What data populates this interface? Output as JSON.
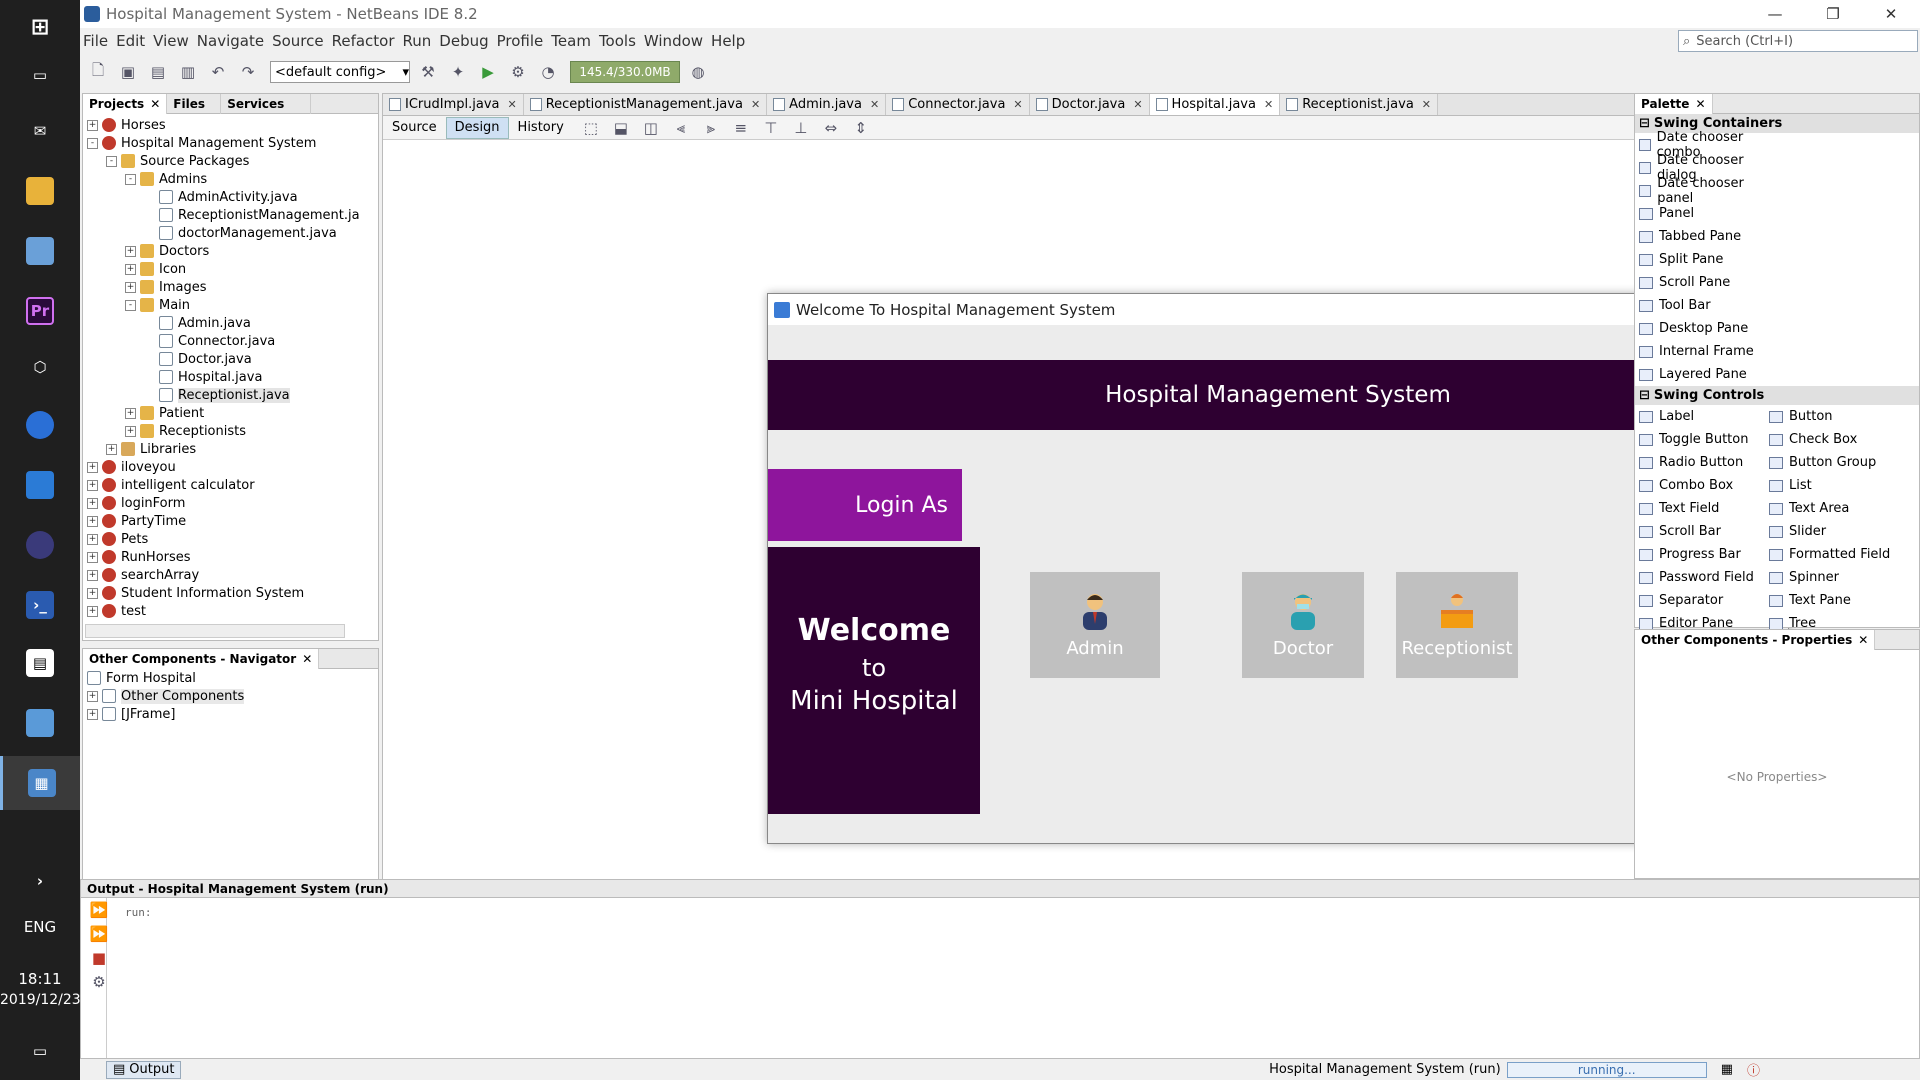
{
  "window": {
    "title": "Hospital Management System - NetBeans IDE 8.2"
  },
  "menu": [
    "File",
    "Edit",
    "View",
    "Navigate",
    "Source",
    "Refactor",
    "Run",
    "Debug",
    "Profile",
    "Team",
    "Tools",
    "Window",
    "Help"
  ],
  "search": {
    "placeholder": "Search (Ctrl+I)"
  },
  "toolbar": {
    "config": "<default config>",
    "memory": "145.4/330.0MB"
  },
  "projects": {
    "tabs": [
      "Projects",
      "Files",
      "Services"
    ],
    "tree": [
      {
        "label": "Horses",
        "depth": 0,
        "type": "proj",
        "exp": "+"
      },
      {
        "label": "Hospital Management System",
        "depth": 0,
        "type": "proj",
        "exp": "-"
      },
      {
        "label": "Source Packages",
        "depth": 1,
        "type": "pkg",
        "exp": "-"
      },
      {
        "label": "Admins",
        "depth": 2,
        "type": "pkg",
        "exp": "-"
      },
      {
        "label": "AdminActivity.java",
        "depth": 3,
        "type": "java",
        "exp": ""
      },
      {
        "label": "ReceptionistManagement.ja",
        "depth": 3,
        "type": "java",
        "exp": ""
      },
      {
        "label": "doctorManagement.java",
        "depth": 3,
        "type": "java",
        "exp": ""
      },
      {
        "label": "Doctors",
        "depth": 2,
        "type": "pkg",
        "exp": "+"
      },
      {
        "label": "Icon",
        "depth": 2,
        "type": "pkg",
        "exp": "+"
      },
      {
        "label": "Images",
        "depth": 2,
        "type": "pkg",
        "exp": "+"
      },
      {
        "label": "Main",
        "depth": 2,
        "type": "pkg",
        "exp": "-"
      },
      {
        "label": "Admin.java",
        "depth": 3,
        "type": "java",
        "exp": ""
      },
      {
        "label": "Connector.java",
        "depth": 3,
        "type": "java",
        "exp": ""
      },
      {
        "label": "Doctor.java",
        "depth": 3,
        "type": "java",
        "exp": ""
      },
      {
        "label": "Hospital.java",
        "depth": 3,
        "type": "java",
        "exp": ""
      },
      {
        "label": "Receptionist.java",
        "depth": 3,
        "type": "java",
        "exp": ""
      },
      {
        "label": "Patient",
        "depth": 2,
        "type": "pkg",
        "exp": "+"
      },
      {
        "label": "Receptionists",
        "depth": 2,
        "type": "pkg",
        "exp": "+"
      },
      {
        "label": "Libraries",
        "depth": 1,
        "type": "lib",
        "exp": "+"
      },
      {
        "label": "iloveyou",
        "depth": 0,
        "type": "proj",
        "exp": "+"
      },
      {
        "label": "intelligent calculator",
        "depth": 0,
        "type": "proj",
        "exp": "+"
      },
      {
        "label": "loginForm",
        "depth": 0,
        "type": "proj",
        "exp": "+"
      },
      {
        "label": "PartyTime",
        "depth": 0,
        "type": "proj",
        "exp": "+"
      },
      {
        "label": "Pets",
        "depth": 0,
        "type": "proj",
        "exp": "+"
      },
      {
        "label": "RunHorses",
        "depth": 0,
        "type": "proj",
        "exp": "+"
      },
      {
        "label": "searchArray",
        "depth": 0,
        "type": "proj",
        "exp": "+"
      },
      {
        "label": "Student Information System",
        "depth": 0,
        "type": "proj",
        "exp": "+"
      },
      {
        "label": "test",
        "depth": 0,
        "type": "proj",
        "exp": "+"
      }
    ]
  },
  "navigator": {
    "title": "Other Components - Navigator",
    "items": [
      "Form Hospital",
      "Other Components",
      "[JFrame]"
    ]
  },
  "editor": {
    "tabs": [
      "ICrudImpl.java",
      "ReceptionistManagement.java",
      "Admin.java",
      "Connector.java",
      "Doctor.java",
      "Hospital.java",
      "Receptionist.java"
    ],
    "active_tab": "Hospital.java",
    "modes": [
      "Source",
      "Design",
      "History"
    ]
  },
  "jframe": {
    "title": "Welcome To Hospital Management System",
    "banner": "Hospital Management System",
    "login_as": "Login As",
    "welcome": "Welcome",
    "to": "to",
    "mini": "Mini Hospital",
    "roles": [
      "Admin",
      "Doctor",
      "Receptionist"
    ]
  },
  "palette": {
    "title": "Palette",
    "cat1": "Swing Containers",
    "containers": [
      "Date chooser combo",
      "Date chooser dialog",
      "Date chooser panel",
      "Panel",
      "Tabbed Pane",
      "Split Pane",
      "Scroll Pane",
      "Tool Bar",
      "Desktop Pane",
      "Internal Frame",
      "Layered Pane"
    ],
    "cat2": "Swing Controls",
    "controls": [
      [
        "Label",
        "Button"
      ],
      [
        "Toggle Button",
        "Check Box"
      ],
      [
        "Radio Button",
        "Button Group"
      ],
      [
        "Combo Box",
        "List"
      ],
      [
        "Text Field",
        "Text Area"
      ],
      [
        "Scroll Bar",
        "Slider"
      ],
      [
        "Progress Bar",
        "Formatted Field"
      ],
      [
        "Password Field",
        "Spinner"
      ],
      [
        "Separator",
        "Text Pane"
      ],
      [
        "Editor Pane",
        "Tree"
      ]
    ]
  },
  "properties": {
    "title": "Other Components - Properties",
    "empty": "<No Properties>"
  },
  "output": {
    "title": "Output - Hospital Management System (run)",
    "text": "run:"
  },
  "status": {
    "output_tab": "Output",
    "project": "Hospital Management System (run)",
    "progress": "running..."
  },
  "taskbar": {
    "lang": "ENG",
    "time": "18:11",
    "date": "2019/12/23"
  }
}
